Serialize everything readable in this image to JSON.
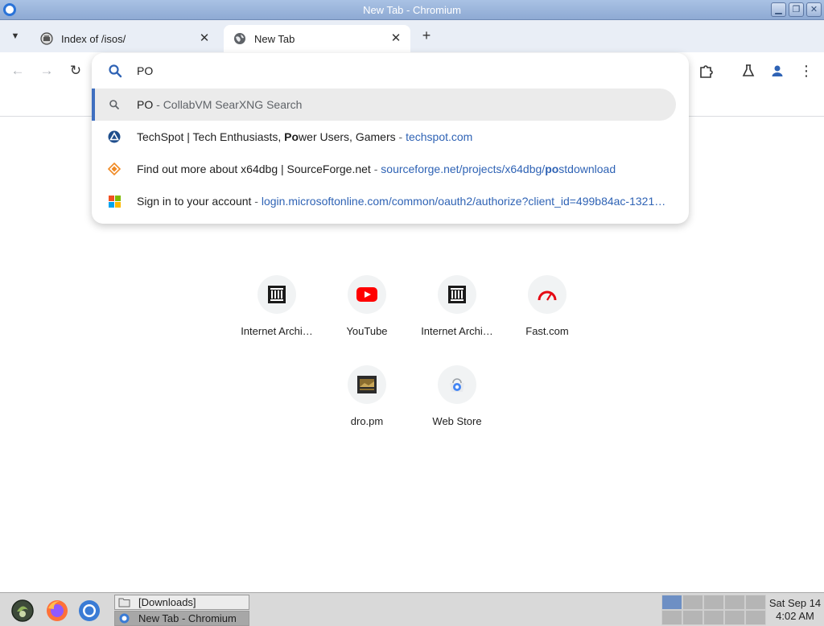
{
  "window": {
    "title": "New Tab - Chromium",
    "controls": [
      "minimize",
      "maximize",
      "close"
    ]
  },
  "tabs": [
    {
      "title": "Index of /isos/",
      "active": false,
      "icon": "archive-favicon"
    },
    {
      "title": "New Tab",
      "active": true,
      "icon": "globe-icon"
    }
  ],
  "omnibox": {
    "input_value": "PO",
    "suggestions": [
      {
        "title": "PO",
        "desc": "CollabVM SearXNG Search",
        "icon": "search-icon",
        "selected": true
      },
      {
        "title_pre": "TechSpot | Tech Enthusiasts, ",
        "title_bold": "Po",
        "title_post": "wer Users, Gamers",
        "url": "techspot.com",
        "icon": "techspot-favicon"
      },
      {
        "title": "Find out more about x64dbg | SourceForge.net",
        "url_pre": "sourceforge.net/projects/x64dbg/",
        "url_bold": "po",
        "url_post": "stdownload",
        "icon": "sourceforge-favicon"
      },
      {
        "title": "Sign in to your account",
        "url": "login.microsoftonline.com/common/oauth2/authorize?client_id=499b84ac-1321…",
        "icon": "microsoft-favicon"
      }
    ]
  },
  "shortcuts": [
    {
      "label": "Internet Archi…",
      "icon": "internet-archive-icon"
    },
    {
      "label": "YouTube",
      "icon": "youtube-icon"
    },
    {
      "label": "Internet Archi…",
      "icon": "internet-archive-icon"
    },
    {
      "label": "Fast.com",
      "icon": "fast-com-icon"
    },
    {
      "label": "dro.pm",
      "icon": "dro-pm-icon"
    },
    {
      "label": "Web Store",
      "icon": "web-store-icon"
    }
  ],
  "taskbar": {
    "tasks": [
      {
        "label": "[Downloads]",
        "icon": "folder-icon",
        "active": false
      },
      {
        "label": "New Tab - Chromium",
        "icon": "chromium-icon",
        "active": true
      }
    ],
    "clock": {
      "date": "Sat Sep 14",
      "time": "4:02 AM"
    }
  },
  "colors": {
    "titlebar": "#9ab4db",
    "tabstrip": "#e9eef6",
    "link": "#2f63b5",
    "selected_accent": "#3f6fc0"
  }
}
